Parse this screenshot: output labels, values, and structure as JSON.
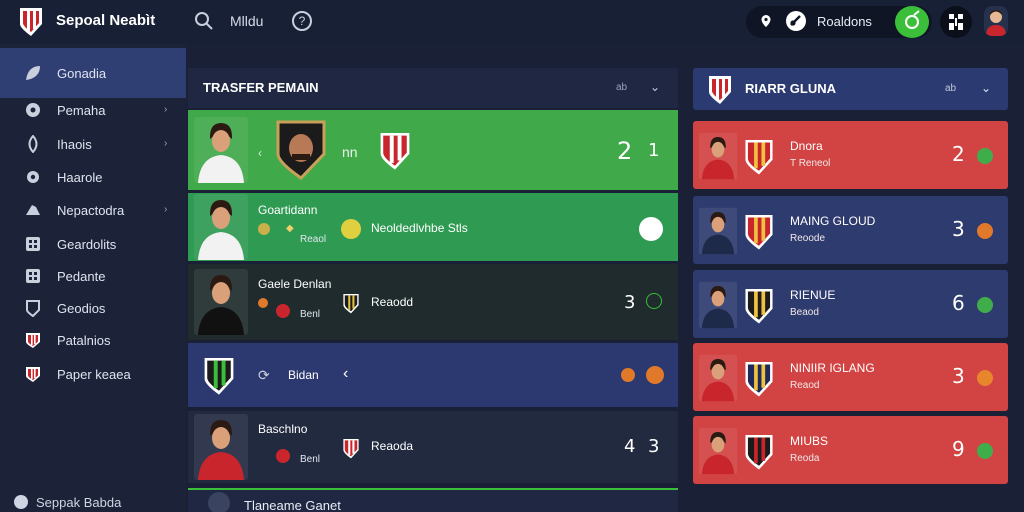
{
  "app": {
    "title": "Sepoal Neabìt"
  },
  "topbar": {
    "menu_label": "Mlldu",
    "help_symbol": "?",
    "results_label": "Roaldons",
    "colors": {
      "accent_green": "#3bbf3a"
    }
  },
  "sidebar": {
    "items": [
      {
        "label": "Gonadia",
        "icon": "leaf-icon",
        "active": true,
        "chevron": false
      },
      {
        "label": "Pemaha",
        "icon": "ball-icon",
        "active": false,
        "chevron": true
      },
      {
        "label": "Ihaois",
        "icon": "drop-icon",
        "active": false,
        "chevron": true
      },
      {
        "label": "Haarole",
        "icon": "gear-icon",
        "active": false,
        "chevron": false
      },
      {
        "label": "Nepactodra",
        "icon": "boot-icon",
        "active": false,
        "chevron": true
      },
      {
        "label": "Geardolits",
        "icon": "grid-icon",
        "active": false,
        "chevron": false
      },
      {
        "label": "Pedante",
        "icon": "grid-icon",
        "active": false,
        "chevron": false
      },
      {
        "label": "Geodios",
        "icon": "shield-icon",
        "active": false,
        "chevron": false
      },
      {
        "label": "Patalnios",
        "icon": "club-crest-icon",
        "active": false,
        "chevron": false
      },
      {
        "label": "Paper keaea",
        "icon": "club-crest-icon",
        "active": false,
        "chevron": false
      }
    ],
    "chevron_symbol": "›",
    "bottom_user": "Seppak Babda"
  },
  "transfer_panel": {
    "title": "TRASFER PEMAIN",
    "filter_label": "ab",
    "chevron_symbol": "⌄",
    "rows": [
      {
        "name": "",
        "sub": "",
        "mid_label": "nn",
        "club": "",
        "score": "2",
        "score2": "1",
        "bg": "#40a94a"
      },
      {
        "name": "Goartidann",
        "sub": "Reaol",
        "mid_label": "",
        "club": "Neoldedlvhbe Stls",
        "score": "",
        "score2": "",
        "bg": "#2f9a52"
      },
      {
        "name": "Gaele Denlan",
        "sub": "Benl",
        "mid_label": "",
        "club": "Reaodd",
        "score": "3",
        "score2": "",
        "bg": "#1f2b2c"
      },
      {
        "name": "Bidan",
        "sub": "",
        "mid_label": "",
        "club": "",
        "score": "",
        "score2": "",
        "bg": "#2c3970"
      },
      {
        "name": "Baschlno",
        "sub": "Benl",
        "mid_label": "",
        "club": "Reaoda",
        "score": "4",
        "score2": "3",
        "bg": "#222a40"
      }
    ],
    "bottom_label": "Tlaneame Ganet"
  },
  "right_panel": {
    "title": "RIARR GLUNA",
    "filter_label": "ab",
    "chevron_symbol": "⌄",
    "cards": [
      {
        "name": "Dnora",
        "sub": "T Reneol",
        "score": "2",
        "color": "red",
        "dot": "#3fae4a"
      },
      {
        "name": "MAING GLOUD",
        "sub": "Reoode",
        "score": "3",
        "color": "blue",
        "dot": "#e07a2a"
      },
      {
        "name": "RIENUE",
        "sub": "Beaod",
        "score": "6",
        "color": "blue",
        "dot": "#3fae4a"
      },
      {
        "name": "NINIIR IGLANG",
        "sub": "Reaod",
        "score": "3",
        "color": "red",
        "dot": "#e8862d"
      },
      {
        "name": "MIUBS",
        "sub": "Reoda",
        "score": "9",
        "color": "red",
        "dot": "#3fae4a"
      }
    ]
  }
}
